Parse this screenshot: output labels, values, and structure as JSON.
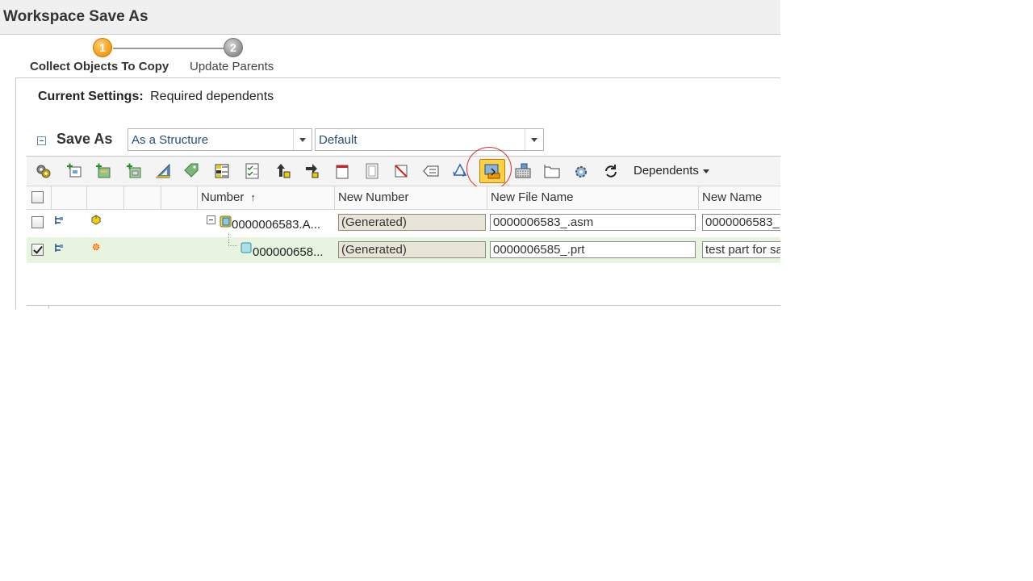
{
  "window": {
    "title": "Workspace Save As"
  },
  "wizard": {
    "steps": [
      {
        "number": "1",
        "label": "Collect Objects To Copy"
      },
      {
        "number": "2",
        "label": "Update Parents"
      }
    ]
  },
  "settings": {
    "label": "Current Settings:",
    "value": "Required dependents"
  },
  "saveas": {
    "label": "Save As",
    "structure_select": "As a Structure",
    "option_select": "Default"
  },
  "toolbar": {
    "icons": [
      "gear-multi-icon",
      "add-object-icon",
      "add-related-icon",
      "add-structure-icon",
      "triangle-ruler-icon",
      "tag-icon",
      "table-grid-icon",
      "checklist-icon",
      "move-up-icon",
      "move-right-icon",
      "page-icon",
      "document-frame-icon",
      "remove-icon",
      "list-icon",
      "recycle-icon",
      "save-as-active-icon",
      "keyboard-icon",
      "folder-icon",
      "settings-gear-icon",
      "refresh-icon"
    ],
    "dependents_label": "Dependents"
  },
  "table": {
    "headers": {
      "number": "Number",
      "new_number": "New Number",
      "new_file_name": "New File Name",
      "new_name": "New Name"
    },
    "sort_indicator": "↑",
    "rows": [
      {
        "number": "0000006583.A...",
        "new_number": "(Generated)",
        "new_file_name": "0000006583_.asm",
        "new_name": "0000006583_",
        "checked": false
      },
      {
        "number": "000000658...",
        "new_number": "(Generated)",
        "new_file_name": "0000006585_.prt",
        "new_name": "test part for sa",
        "checked": true
      }
    ]
  },
  "colors": {
    "accent_orange": "#f39a12",
    "active_tool": "#ffcf45",
    "highlight_red": "#e0302c",
    "selected_row": "#e6f4e0"
  }
}
